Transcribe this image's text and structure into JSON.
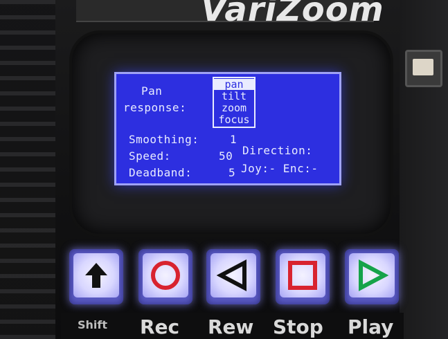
{
  "device": {
    "brand": "VariZoom"
  },
  "screen": {
    "title_line1": "Pan",
    "title_line2": "response:",
    "axes": [
      {
        "label": "pan",
        "selected": true
      },
      {
        "label": "tilt",
        "selected": false
      },
      {
        "label": "zoom",
        "selected": false
      },
      {
        "label": "focus",
        "selected": false
      }
    ],
    "smoothing_label": "Smoothing:",
    "smoothing_value": "1",
    "speed_label": "Speed:",
    "speed_value": "50",
    "deadband_label": "Deadband:",
    "deadband_value": "5",
    "direction_label": "Direction:",
    "direction_value": "Joy:- Enc:-",
    "colors": {
      "background": "#2d2fe0",
      "text": "#e9ecff"
    }
  },
  "buttons": [
    {
      "name": "shift",
      "label": "Shift",
      "icon": "up-arrow-icon"
    },
    {
      "name": "rec",
      "label": "Rec",
      "icon": "circle-icon",
      "color": "#d8232f"
    },
    {
      "name": "rew",
      "label": "Rew",
      "icon": "triangle-left-icon",
      "color": "#111111"
    },
    {
      "name": "stop",
      "label": "Stop",
      "icon": "square-icon",
      "color": "#d8232f"
    },
    {
      "name": "play",
      "label": "Play",
      "icon": "triangle-right-icon",
      "color": "#16a34a"
    }
  ]
}
